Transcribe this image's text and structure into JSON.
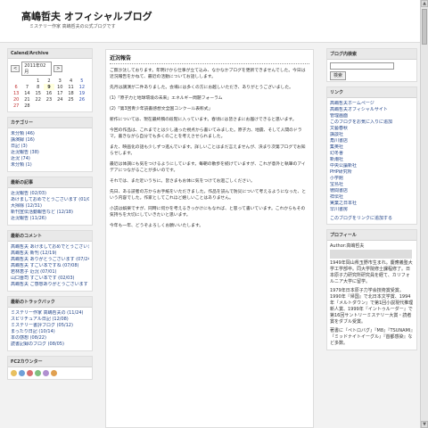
{
  "header": {
    "title": "高嶋哲夫 オフィシャルブログ",
    "description": "ミステリー作家 高嶋哲夫の公式ブログです"
  },
  "calendar": {
    "title": "Calend/Archive",
    "prev": "<",
    "month": "2011年02月",
    "next": ">",
    "weeks": [
      [
        "",
        "",
        "1",
        "2",
        "3",
        "4",
        "5"
      ],
      [
        "6",
        "7",
        "8",
        "9",
        "10",
        "11",
        "12"
      ],
      [
        "13",
        "14",
        "15",
        "16",
        "17",
        "18",
        "19"
      ],
      [
        "20",
        "21",
        "22",
        "23",
        "24",
        "25",
        "26"
      ],
      [
        "27",
        "28",
        "",
        "",
        "",
        "",
        ""
      ]
    ]
  },
  "categories": {
    "title": "カテゴリー",
    "items": [
      "未分類 (46)",
      "講演録 (16)",
      "日記 (3)",
      "近況報告 (38)",
      "近況 (74)",
      "未分類 (1)"
    ]
  },
  "recent_posts": {
    "title": "最新の記事",
    "items": [
      "近況報告 (02/03)",
      "あけましておめでとうございます (01/01)",
      "大掃除 (12/31)",
      "新刊宣伝活動報告など (12/18)",
      "近況報告 (11/26)"
    ]
  },
  "recent_comments": {
    "title": "最新のコメント",
    "items": [
      "高嶋哲夫 あけましておめでとうございます (01/02)",
      "高嶋哲夫 新刊 (12/19)",
      "高嶋哲夫 ありがとうございます (07/24)",
      "高嶋哲夫 すごい本ですね (07/08)",
      "若林恵子 近況 (07/01)",
      "山口晋司 すごい本です (02/03)",
      "高嶋哲夫 ご感想ありがとうございます (01/25)"
    ]
  },
  "recent_trackbacks": {
    "title": "最新のトラックバック",
    "items": [
      "ミステリー作家 高嶋哲夫の (11/24)",
      "スピリチュアル日記 (12/08)",
      "ミステリー書評ブログ (05/12)",
      "まったり日記 (10/14)",
      "本の感想 (08/22)",
      "読書記録のブログ (08/05)"
    ]
  },
  "counter": {
    "title": "FC2カウンター"
  },
  "main": {
    "title": "近況報告",
    "paragraphs": [
      "ご無沙汰しております。年明けから仕事が立て込み、なかなかブログを更新できませんでした。今日は近況報告をかねて、最近の活動についてお話しします。",
      "先月は講演が二件ありました。会場には多くの方にお越しいただき、ありがとうございました。",
      "(1)「原子力と地球環境の未来」エネルギー問題フォーラム",
      "(2)「第3回青少年読書感想文全国コンクール表彰式」",
      "新作については、現在最終稿の段階に入っています。春頃には皆さまにお届けできると思います。",
      "今回の作品は、これまでとは少し違った視点から書いてみました。原子力、地震、そして人間のドラマ。書きながら自分でも多くのことを考えさせられました。",
      "また、映画化の話も少しずつ進んでいます。詳しいことはまだ言えませんが、決まり次第ブログでお知らせします。",
      "最近は体調にも気をつけるようにしています。毎朝の散歩を続けていますが、これが意外と執筆のアイデアにつながることが多いのです。",
      "それでは、また近いうちに。皆さまもお体に気をつけてお過ごしください。",
      "先日、ある読者の方からお手紙をいただきました。作品を読んで防災について考えるようになった、という内容でした。作家としてこれほど嬉しいことはありません。",
      "小説は娯楽ですが、同時に何かを考えるきっかけにもなれば、と思って書いています。これからもその気持ちを大切にしていきたいと思います。",
      "今年も一年、どうぞよろしくお願いいたします。"
    ]
  },
  "blog_search": {
    "title": "ブログ内検索",
    "placeholder": "",
    "button": "検索"
  },
  "links": {
    "title": "リンク",
    "items": [
      "高嶋哲夫ホームページ",
      "高嶋哲夫オフィシャルサイト",
      "管理画面",
      "このブログをお気に入りに追加",
      "文藝春秋",
      "講談社",
      "角川書店",
      "集英社",
      "幻冬舎",
      "新潮社",
      "中央公論新社",
      "PHP研究所",
      "小学館",
      "宝島社",
      "徳間書店",
      "祥伝社",
      "実業之日本社",
      "早川書房"
    ],
    "footer": "このブログをリンクに追加する"
  },
  "profile": {
    "title": "プロフィール",
    "name": "Author:高嶋哲夫",
    "lines": [
      "1949年岡山県玉野市生まれ。慶應義塾大学工学部卒。同大学院修士課程修了。日本原子力研究所研究員を経て、カリフォルニア大学に留学。",
      "1979年日本原子力学会技術賞受賞。1990年『帰国』で北日本文学賞、1994年『メルトダウン』で第1回小説現代推理新人賞、1999年『イントゥルーダー』で第16回サントリーミステリー大賞・読者賞をダブル受賞。",
      "著書に『ペトロバグ』『M8』『TSUNAMI』『ミッドナイトイーグル』『首都感染』など多数。"
    ]
  },
  "colors": {
    "link": "#224488",
    "box_title_bg": "#e9e9e9",
    "page_bg": "#f2f2f2"
  }
}
